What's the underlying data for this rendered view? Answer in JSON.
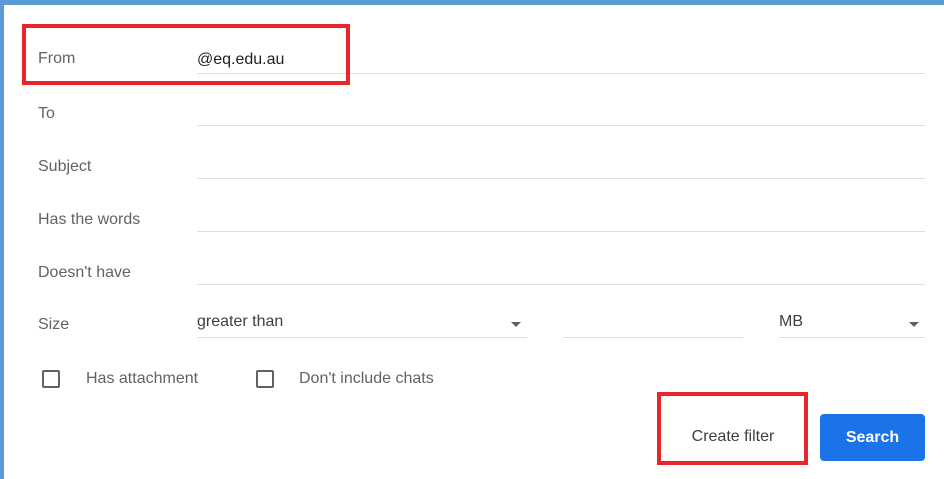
{
  "form": {
    "from_label": "From",
    "from_value": "@eq.edu.au",
    "to_label": "To",
    "to_value": "",
    "subject_label": "Subject",
    "subject_value": "",
    "has_words_label": "Has the words",
    "has_words_value": "",
    "doesnt_have_label": "Doesn't have",
    "doesnt_have_value": "",
    "size_label": "Size",
    "size_comparator": "greater than",
    "size_value": "",
    "size_unit": "MB",
    "has_attachment_label": "Has attachment",
    "has_attachment_checked": false,
    "dont_include_chats_label": "Don't include chats",
    "dont_include_chats_checked": false
  },
  "actions": {
    "create_filter_label": "Create filter",
    "search_label": "Search"
  },
  "colors": {
    "frame_border": "#5b9bd5",
    "highlight": "#e8262a",
    "search_button": "#1a73e8"
  }
}
